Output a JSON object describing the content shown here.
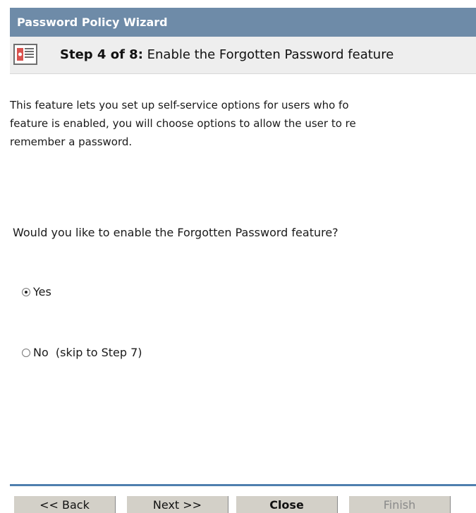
{
  "wizard": {
    "title": "Password Policy Wizard",
    "step_label": "Step 4 of 8:",
    "step_title": "Enable the Forgotten Password feature"
  },
  "description": {
    "line1": "This feature lets you set up self-service options for users who fo",
    "line2": "feature is enabled, you will choose options to allow the user to re",
    "line3": "remember a password."
  },
  "question": "Would you like to enable the Forgotten Password feature?",
  "options": [
    {
      "label": "Yes",
      "selected": true
    },
    {
      "label": "No  (skip to Step 7)",
      "selected": false
    }
  ],
  "buttons": {
    "back": "<< Back",
    "next": "Next >>",
    "close": "Close",
    "finish": "Finish"
  },
  "colors": {
    "title_bar": "#6e8ba8",
    "step_bar": "#eeeeee",
    "footer_rule": "#4f7fae",
    "button_face": "#d3d0c8",
    "disabled_text": "#8a8a8a"
  },
  "icons": {
    "step_icon": "wizard-step-icon",
    "radio_selected": "radio-selected-icon",
    "radio_unselected": "radio-unselected-icon"
  }
}
